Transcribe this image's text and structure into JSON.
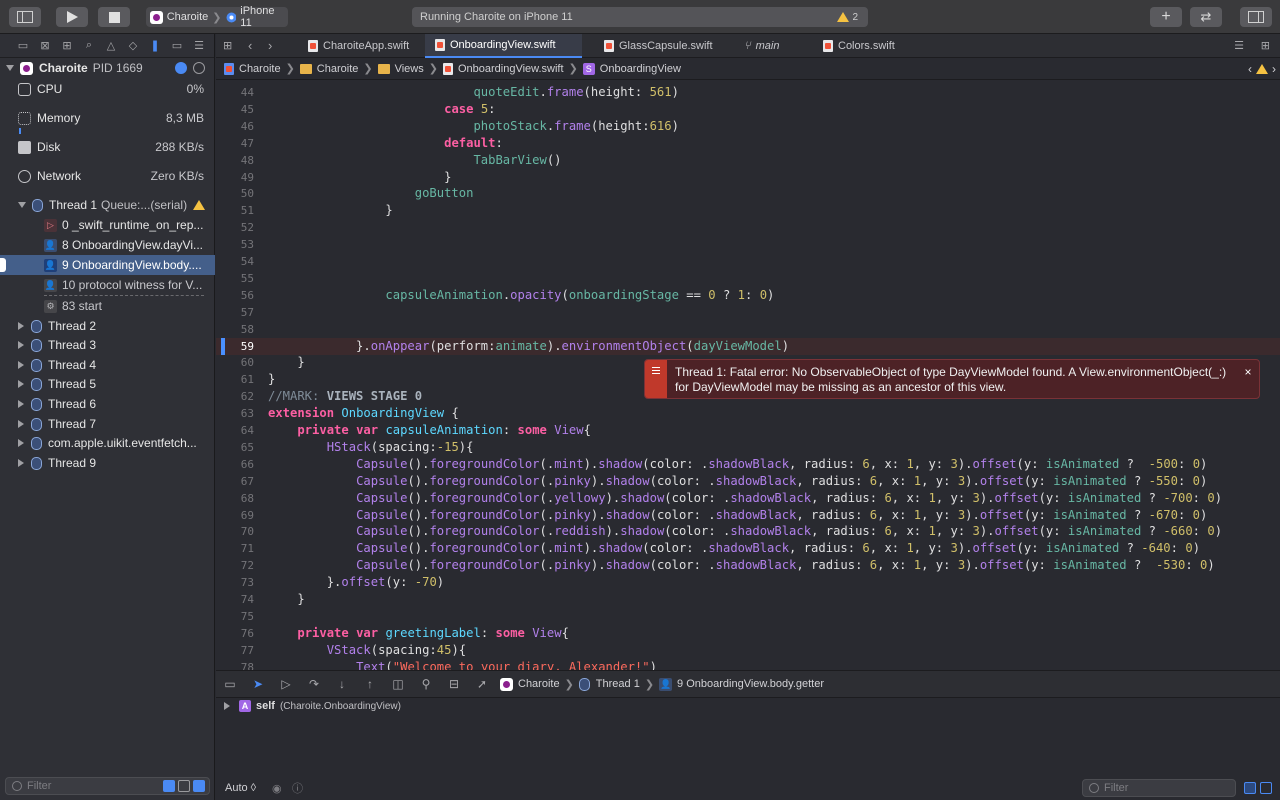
{
  "toolbar": {
    "scheme_app": "Charoite",
    "scheme_device": "iPhone 11",
    "status_text": "Running Charoite on iPhone 11",
    "warning_count": "2"
  },
  "navigator": {
    "process": {
      "name": "Charoite",
      "pid": "PID 1669"
    },
    "gauges": [
      {
        "name": "CPU",
        "value": "0%"
      },
      {
        "name": "Memory",
        "value": "8,3 MB"
      },
      {
        "name": "Disk",
        "value": "288 KB/s"
      },
      {
        "name": "Network",
        "value": "Zero KB/s"
      }
    ],
    "thread1": {
      "name": "Thread 1",
      "queue": "Queue:...(serial)"
    },
    "frames": [
      {
        "label": "0 _swift_runtime_on_rep..."
      },
      {
        "label": "8 OnboardingView.dayVi..."
      },
      {
        "label": "9 OnboardingView.body...."
      },
      {
        "label": "10 protocol witness for V..."
      },
      {
        "label": "83 start"
      }
    ],
    "threads": [
      {
        "label": "Thread 2"
      },
      {
        "label": "Thread 3"
      },
      {
        "label": "Thread 4"
      },
      {
        "label": "Thread 5"
      },
      {
        "label": "Thread 6"
      },
      {
        "label": "Thread 7"
      },
      {
        "label": "com.apple.uikit.eventfetch..."
      },
      {
        "label": "Thread 9"
      }
    ],
    "filter_placeholder": "Filter"
  },
  "tabs": [
    {
      "label": "CharoiteApp.swift"
    },
    {
      "label": "OnboardingView.swift"
    },
    {
      "label": "GlassCapsule.swift"
    },
    {
      "label": "main"
    },
    {
      "label": "Colors.swift"
    }
  ],
  "jumpbar": {
    "project": "Charoite",
    "group": "Charoite",
    "folder": "Views",
    "file": "OnboardingView.swift",
    "symbol": "OnboardingView"
  },
  "code_lines": [
    {
      "n": "44",
      "html": "                            <span class=\"prop\">quoteEdit</span>.<span class=\"mem\">frame</span>(height: <span class=\"num\">561</span>)"
    },
    {
      "n": "45",
      "html": "                        <span class=\"kw\">case</span> <span class=\"num\">5</span>:"
    },
    {
      "n": "46",
      "html": "                            <span class=\"prop\">photoStack</span>.<span class=\"mem\">frame</span>(height:<span class=\"num\">616</span>)"
    },
    {
      "n": "47",
      "html": "                        <span class=\"kw\">default</span>:"
    },
    {
      "n": "48",
      "html": "                            <span class=\"prop\">TabBarView</span>()"
    },
    {
      "n": "49",
      "html": "                        }"
    },
    {
      "n": "50",
      "html": "                    <span class=\"prop\">goButton</span>"
    },
    {
      "n": "51",
      "html": "                }"
    },
    {
      "n": "52",
      "html": ""
    },
    {
      "n": "53",
      "html": ""
    },
    {
      "n": "54",
      "html": ""
    },
    {
      "n": "55",
      "html": ""
    },
    {
      "n": "56",
      "html": "                <span class=\"prop\">capsuleAnimation</span>.<span class=\"mem\">opacity</span>(<span class=\"prop\">onboardingStage</span> == <span class=\"num\">0</span> ? <span class=\"num\">1</span>: <span class=\"num\">0</span>)"
    },
    {
      "n": "57",
      "html": ""
    },
    {
      "n": "58",
      "html": ""
    },
    {
      "n": "59",
      "html": "            }.<span class=\"mem\">onAppear</span>(perform:<span class=\"prop\">animate</span>).<span class=\"mem\">environmentObject</span>(<span class=\"prop\">dayViewModel</span>)"
    },
    {
      "n": "60",
      "html": "    }"
    },
    {
      "n": "61",
      "html": "}"
    },
    {
      "n": "62",
      "html": "<span class=\"cmt\">//MARK: </span><span class=\"cmtb\">VIEWS STAGE 0</span>"
    },
    {
      "n": "63",
      "html": "<span class=\"kw\">extension</span> <span class=\"ty\">OnboardingView</span> {"
    },
    {
      "n": "64",
      "html": "    <span class=\"kw\">private</span> <span class=\"kw\">var</span> <span class=\"ty\">capsuleAnimation</span>: <span class=\"kw\">some</span> <span class=\"mem\">View</span>{"
    },
    {
      "n": "65",
      "html": "        <span class=\"mem\">HStack</span>(spacing:<span class=\"num\">-15</span>){"
    },
    {
      "n": "66",
      "html": "            <span class=\"mem\">Capsule</span>().<span class=\"mem\">foregroundColor</span>(.<span class=\"mem\">mint</span>).<span class=\"mem\">shadow</span>(color: .<span class=\"mem\">shadowBlack</span>, radius: <span class=\"num\">6</span>, x: <span class=\"num\">1</span>, y: <span class=\"num\">3</span>).<span class=\"mem\">offset</span>(y: <span class=\"prop\">isAnimated</span> ?  <span class=\"num\">-500</span>: <span class=\"num\">0</span>)"
    },
    {
      "n": "67",
      "html": "            <span class=\"mem\">Capsule</span>().<span class=\"mem\">foregroundColor</span>(.<span class=\"mem\">pinky</span>).<span class=\"mem\">shadow</span>(color: .<span class=\"mem\">shadowBlack</span>, radius: <span class=\"num\">6</span>, x: <span class=\"num\">1</span>, y: <span class=\"num\">3</span>).<span class=\"mem\">offset</span>(y: <span class=\"prop\">isAnimated</span> ? <span class=\"num\">-550</span>: <span class=\"num\">0</span>)"
    },
    {
      "n": "68",
      "html": "            <span class=\"mem\">Capsule</span>().<span class=\"mem\">foregroundColor</span>(.<span class=\"mem\">yellowy</span>).<span class=\"mem\">shadow</span>(color: .<span class=\"mem\">shadowBlack</span>, radius: <span class=\"num\">6</span>, x: <span class=\"num\">1</span>, y: <span class=\"num\">3</span>).<span class=\"mem\">offset</span>(y: <span class=\"prop\">isAnimated</span> ? <span class=\"num\">-700</span>: <span class=\"num\">0</span>)"
    },
    {
      "n": "69",
      "html": "            <span class=\"mem\">Capsule</span>().<span class=\"mem\">foregroundColor</span>(.<span class=\"mem\">pinky</span>).<span class=\"mem\">shadow</span>(color: .<span class=\"mem\">shadowBlack</span>, radius: <span class=\"num\">6</span>, x: <span class=\"num\">1</span>, y: <span class=\"num\">3</span>).<span class=\"mem\">offset</span>(y: <span class=\"prop\">isAnimated</span> ? <span class=\"num\">-670</span>: <span class=\"num\">0</span>)"
    },
    {
      "n": "70",
      "html": "            <span class=\"mem\">Capsule</span>().<span class=\"mem\">foregroundColor</span>(.<span class=\"mem\">reddish</span>).<span class=\"mem\">shadow</span>(color: .<span class=\"mem\">shadowBlack</span>, radius: <span class=\"num\">6</span>, x: <span class=\"num\">1</span>, y: <span class=\"num\">3</span>).<span class=\"mem\">offset</span>(y: <span class=\"prop\">isAnimated</span> ? <span class=\"num\">-660</span>: <span class=\"num\">0</span>)"
    },
    {
      "n": "71",
      "html": "            <span class=\"mem\">Capsule</span>().<span class=\"mem\">foregroundColor</span>(.<span class=\"mem\">mint</span>).<span class=\"mem\">shadow</span>(color: .<span class=\"mem\">shadowBlack</span>, radius: <span class=\"num\">6</span>, x: <span class=\"num\">1</span>, y: <span class=\"num\">3</span>).<span class=\"mem\">offset</span>(y: <span class=\"prop\">isAnimated</span> ? <span class=\"num\">-640</span>: <span class=\"num\">0</span>)"
    },
    {
      "n": "72",
      "html": "            <span class=\"mem\">Capsule</span>().<span class=\"mem\">foregroundColor</span>(.<span class=\"mem\">pinky</span>).<span class=\"mem\">shadow</span>(color: .<span class=\"mem\">shadowBlack</span>, radius: <span class=\"num\">6</span>, x: <span class=\"num\">1</span>, y: <span class=\"num\">3</span>).<span class=\"mem\">offset</span>(y: <span class=\"prop\">isAnimated</span> ?  <span class=\"num\">-530</span>: <span class=\"num\">0</span>)"
    },
    {
      "n": "73",
      "html": "        }.<span class=\"mem\">offset</span>(y: <span class=\"num\">-70</span>)"
    },
    {
      "n": "74",
      "html": "    }"
    },
    {
      "n": "75",
      "html": ""
    },
    {
      "n": "76",
      "html": "    <span class=\"kw\">private</span> <span class=\"kw\">var</span> <span class=\"ty\">greetingLabel</span>: <span class=\"kw\">some</span> <span class=\"mem\">View</span>{"
    },
    {
      "n": "77",
      "html": "        <span class=\"mem\">VStack</span>(spacing:<span class=\"num\">45</span>){"
    },
    {
      "n": "78",
      "html": "            <span class=\"mem\">Text</span>(<span class=\"str\">\"Welcome to your diary, Alexander!\"</span>)"
    }
  ],
  "error": {
    "message": "Thread 1: Fatal error: No ObservableObject of type DayViewModel found. A View.environmentObject(_:) for DayViewModel may be missing as an ancestor of this view.",
    "close": "×"
  },
  "debugbar": {
    "app": "Charoite",
    "thread": "Thread 1",
    "frame": "9 OnboardingView.body.getter"
  },
  "variables": {
    "name": "self",
    "type": "(Charoite.OnboardingView)",
    "badge": "A"
  },
  "bottom": {
    "mode": "Auto ◊",
    "filter_placeholder": "Filter"
  },
  "colors": {
    "keyword": "#fc5fa3",
    "error_bg": "#4d2226",
    "selection": "#445f8a",
    "accent": "#4a8af4"
  }
}
